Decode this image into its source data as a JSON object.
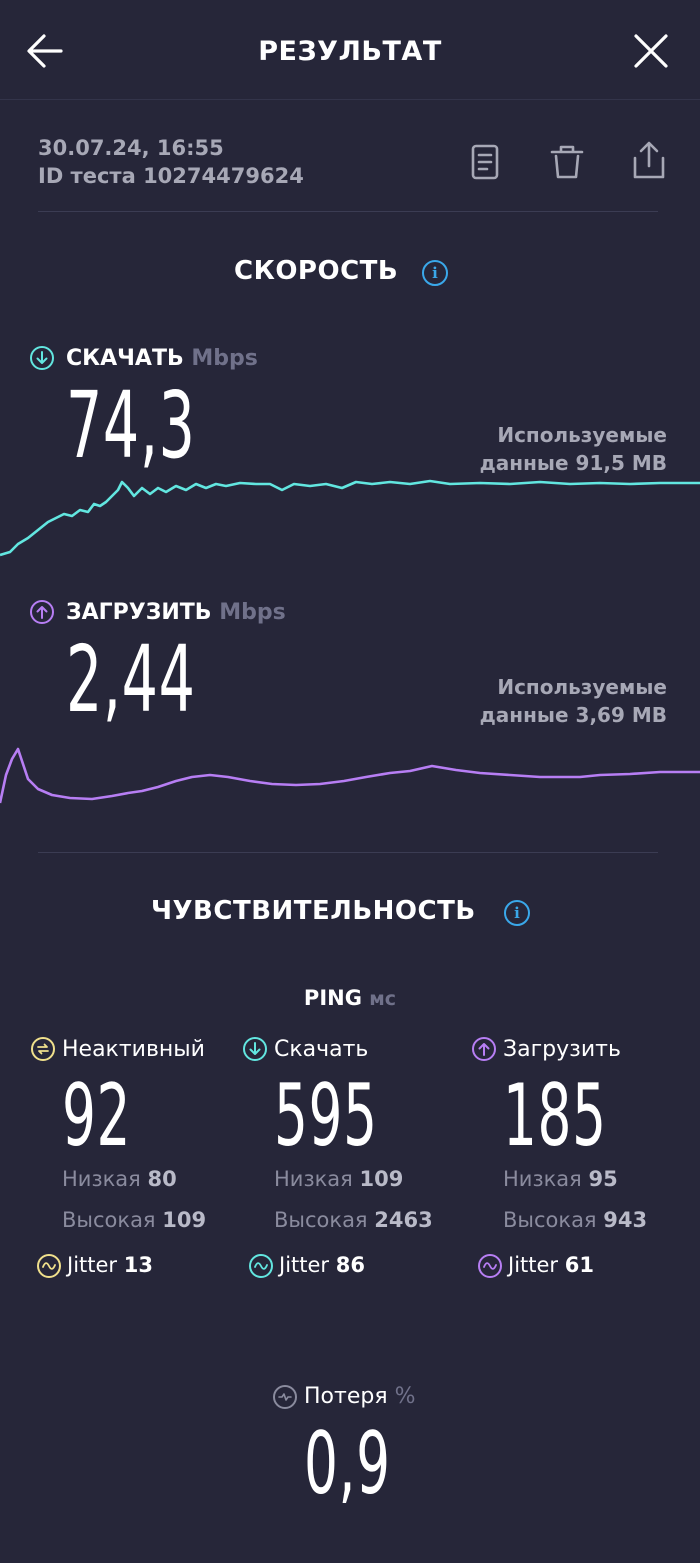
{
  "header": {
    "title": "РЕЗУЛЬТАТ",
    "back_icon": "arrow-left-icon",
    "close_icon": "close-icon"
  },
  "meta": {
    "datetime": "30.07.24, 16:55",
    "test_id": "ID теста 10274479624"
  },
  "toolbar": {
    "icons": [
      "document-icon",
      "trash-icon",
      "share-icon"
    ]
  },
  "speed": {
    "title": "СКОРОСТЬ",
    "download": {
      "label": "СКАЧАТЬ",
      "unit": "Mbps",
      "value": "74,3",
      "used_line1": "Используемые",
      "used_line2": "данные 91,5 MB",
      "color": "#62e6e0"
    },
    "upload": {
      "label": "ЗАГРУЗИТЬ",
      "unit": "Mbps",
      "value": "2,44",
      "used_line1": "Используемые",
      "used_line2": "данные 3,69 MB",
      "color": "#b77ef4"
    }
  },
  "responsiveness": {
    "title": "ЧУВСТВИТЕЛЬНОСТЬ",
    "ping_label": "PING",
    "ping_unit": "мс",
    "columns": [
      {
        "label": "Неактивный",
        "value": "92",
        "low_label": "Низкая",
        "low": "80",
        "high_label": "Высокая",
        "high": "109",
        "jitter_label": "Jitter",
        "jitter": "13",
        "color": "#f0e08c"
      },
      {
        "label": "Скачать",
        "value": "595",
        "low_label": "Низкая",
        "low": "109",
        "high_label": "Высокая",
        "high": "2463",
        "jitter_label": "Jitter",
        "jitter": "86",
        "color": "#62e6e0"
      },
      {
        "label": "Загрузить",
        "value": "185",
        "low_label": "Низкая",
        "low": "95",
        "high_label": "Высокая",
        "high": "943",
        "jitter_label": "Jitter",
        "jitter": "61",
        "color": "#b77ef4"
      }
    ],
    "loss": {
      "label": "Потеря",
      "unit": "%",
      "value": "0,9"
    }
  }
}
